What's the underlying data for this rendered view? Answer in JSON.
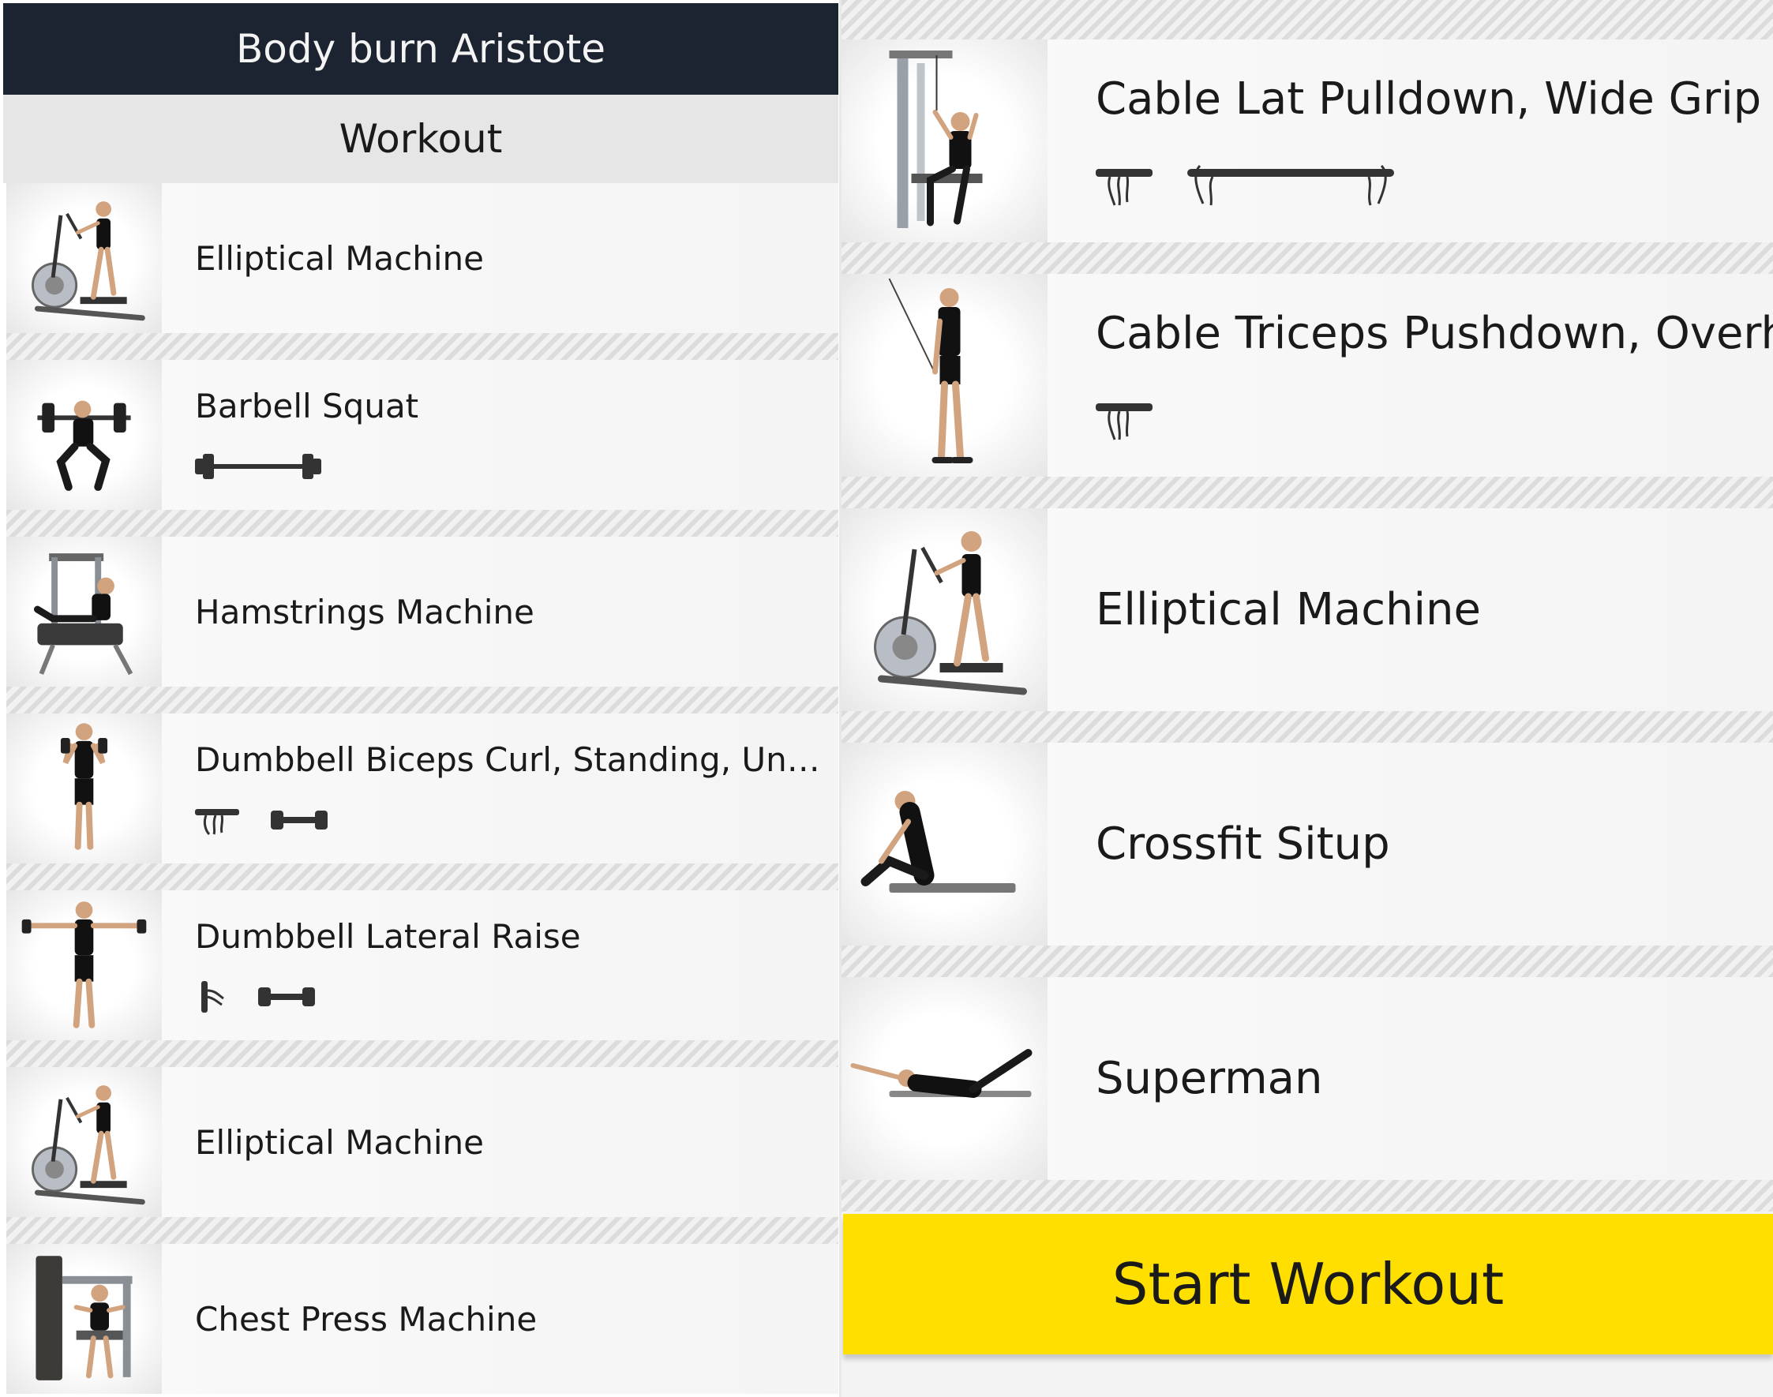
{
  "header": {
    "title": "Body burn Aristote"
  },
  "section": {
    "title": "Workout"
  },
  "left_list": [
    {
      "name": "Elliptical Machine",
      "equipment": []
    },
    {
      "name": "Barbell Squat",
      "equipment": [
        "barbell-icon"
      ]
    },
    {
      "name": "Hamstrings Machine",
      "equipment": []
    },
    {
      "name": "Dumbbell Biceps Curl, Standing, Under…",
      "equipment": [
        "underhand-grip-icon",
        "dumbbell-icon"
      ]
    },
    {
      "name": "Dumbbell Lateral Raise",
      "equipment": [
        "neutral-grip-icon",
        "dumbbell-icon"
      ]
    },
    {
      "name": "Elliptical Machine",
      "equipment": []
    },
    {
      "name": "Chest Press Machine",
      "equipment": []
    }
  ],
  "right_list": [
    {
      "name": "Cable Lat Pulldown, Wide Grip",
      "equipment": [
        "handle-grip-icon",
        "wide-bar-icon"
      ]
    },
    {
      "name": "Cable Triceps Pushdown, Overha",
      "equipment": [
        "handle-grip-icon"
      ]
    },
    {
      "name": "Elliptical Machine",
      "equipment": []
    },
    {
      "name": "Crossfit Situp",
      "equipment": []
    },
    {
      "name": "Superman",
      "equipment": []
    }
  ],
  "start_button": {
    "label": "Start Workout"
  },
  "colors": {
    "header_bg": "#1d2431",
    "accent": "#ffdf00"
  }
}
